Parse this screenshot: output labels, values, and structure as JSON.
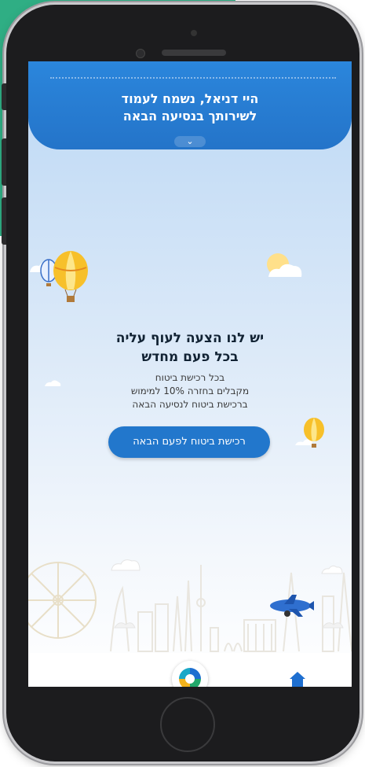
{
  "header": {
    "greeting_line1": "היי דניאל, נשמח לעמוד",
    "greeting_line2": "לשירותך בנסיעה הבאה",
    "expand_icon": "chevron-down-icon"
  },
  "promo": {
    "title_line1": "יש לנו הצעה לעוף עליה",
    "title_line2": "בכל פעם מחדש",
    "body_line1": "בכל רכישת ביטוח",
    "body_line2": "מקבלים בחזרה 10% למימוש",
    "body_line3": "ברכישת ביטוח לנסיעה הבאה"
  },
  "cta": {
    "label": "רכישת ביטוח לפעם הבאה"
  },
  "bottom_nav": {
    "center_icon": "app-logo-icon",
    "right_icon": "home-icon"
  },
  "colors": {
    "header": "#2a80d6",
    "cta": "#2277cc",
    "background_green": "#2fae84",
    "sky_top": "#bcd8f5"
  }
}
